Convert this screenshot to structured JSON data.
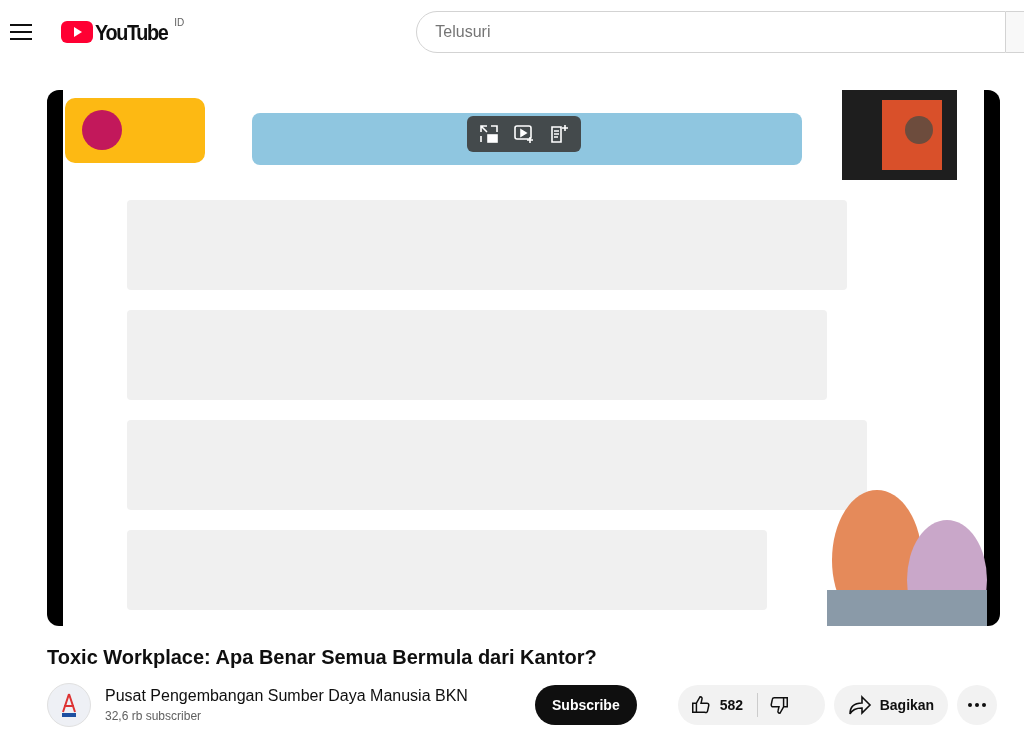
{
  "header": {
    "logo_text": "YouTube",
    "country_code": "ID",
    "search": {
      "placeholder": "Telusuri"
    }
  },
  "video_title": "Toxic Workplace: Apa Benar Semua Bermula dari Kantor?",
  "channel": {
    "name": "Pusat Pengembangan Sumber Daya Manusia BKN",
    "subscribers": "32,6 rb subscriber",
    "subscribe_label": "Subscribe"
  },
  "actions": {
    "likes": "582",
    "share_label": "Bagikan"
  }
}
